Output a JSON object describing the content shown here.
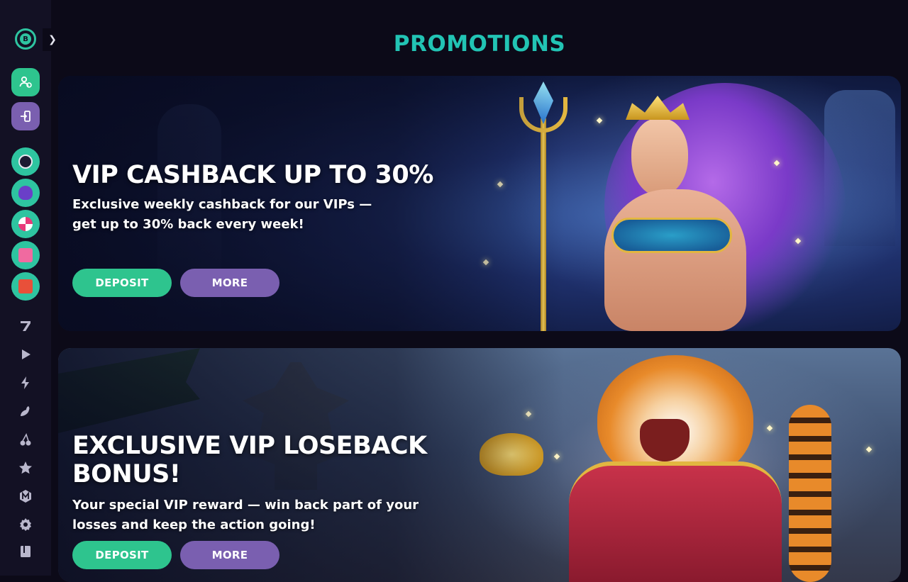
{
  "page": {
    "title": "PROMOTIONS"
  },
  "sidebar": {
    "logo_letter": "B",
    "expand_icon": "chevron-right-icon",
    "buttons": [
      {
        "name": "register-button",
        "icon": "user-add-icon",
        "color": "#2ec48e"
      },
      {
        "name": "login-button",
        "icon": "login-icon",
        "color": "#7a5fb0"
      }
    ],
    "features": [
      {
        "name": "vip-club",
        "icon": "vip-icon"
      },
      {
        "name": "mascot-game",
        "icon": "monster-icon"
      },
      {
        "name": "wheel-of-fortune",
        "icon": "wheel-icon"
      },
      {
        "name": "gifts",
        "icon": "gift-icon"
      },
      {
        "name": "lottery",
        "icon": "ticket-icon"
      }
    ],
    "nav": [
      {
        "name": "slots",
        "icon": "seven-icon"
      },
      {
        "name": "live",
        "icon": "play-icon"
      },
      {
        "name": "fast-games",
        "icon": "lightning-icon"
      },
      {
        "name": "hot-games",
        "icon": "chili-icon"
      },
      {
        "name": "fruits",
        "icon": "cherry-icon"
      },
      {
        "name": "favourites",
        "icon": "star-icon"
      },
      {
        "name": "megaways",
        "icon": "megaways-icon"
      },
      {
        "name": "providers",
        "icon": "settings-icon"
      },
      {
        "name": "tournaments",
        "icon": "book-icon"
      }
    ]
  },
  "promos": [
    {
      "title": "VIP CASHBACK UP TO 30%",
      "text_line1": "Exclusive weekly cashback for our VIPs —",
      "text_line2": "get up to 30% back every week!",
      "deposit_label": "DEPOSIT",
      "more_label": "MORE"
    },
    {
      "title_line1": "EXCLUSIVE VIP LOSEBACK",
      "title_line2": "BONUS!",
      "text_line1": "Your special VIP reward — win back part of your",
      "text_line2": "losses and keep the action going!",
      "deposit_label": "DEPOSIT",
      "more_label": "MORE"
    }
  ],
  "colors": {
    "accent_teal": "#22c4b4",
    "deposit_green": "#2ec48e",
    "more_purple": "#7a5fb0",
    "background": "#0c0a18",
    "sidebar": "#131124"
  }
}
